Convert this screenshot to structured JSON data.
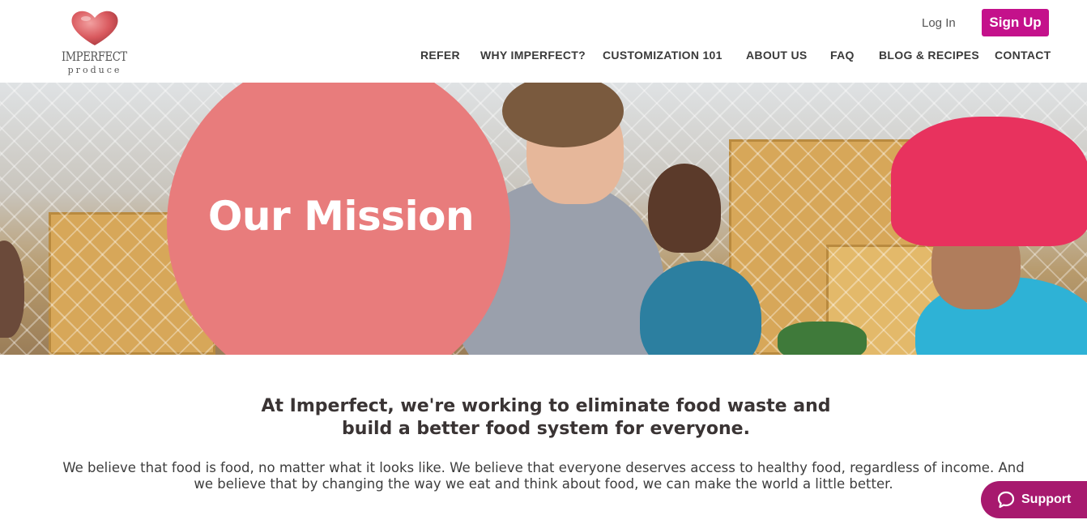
{
  "header": {
    "logo_word": "IMPERFECT",
    "logo_sub": "produce",
    "login_label": "Log In",
    "signup_label": "Sign Up"
  },
  "nav": {
    "items": [
      "REFER",
      "WHY IMPERFECT?",
      "CUSTOMIZATION 101",
      "ABOUT US",
      "FAQ",
      "BLOG & RECIPES",
      "CONTACT"
    ]
  },
  "hero": {
    "title": "Our Mission"
  },
  "content": {
    "headline_line1": "At Imperfect, we're working to eliminate food waste and",
    "headline_line2": "build a better food system for everyone.",
    "body_line1": "We believe that food is food, no matter what it looks like. We believe that everyone deserves access to healthy food, regardless of income. And",
    "body_line2": "we believe that by changing the way we eat and think about food, we can make the world a little better."
  },
  "support": {
    "label": "Support",
    "icon": "chat-bubble-icon"
  },
  "colors": {
    "brand_magenta": "#c4118b",
    "support_purple": "#a7196e",
    "mission_circle": "#e87c7c"
  }
}
